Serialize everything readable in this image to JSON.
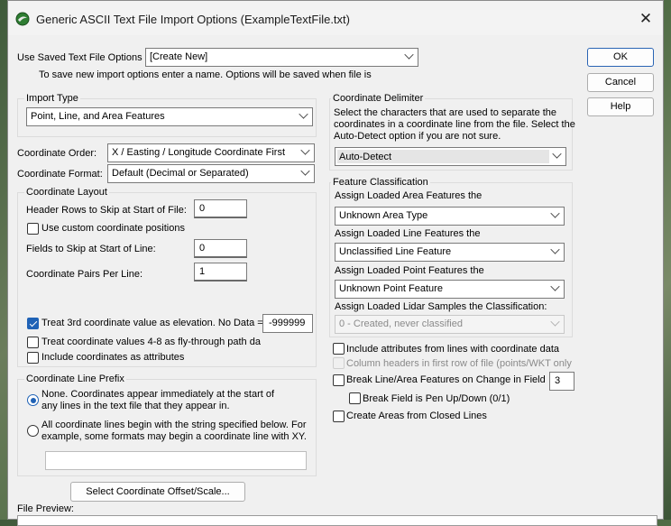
{
  "window": {
    "title": "Generic ASCII Text File Import Options (ExampleTextFile.txt)"
  },
  "saved": {
    "label": "Use Saved Text File Options",
    "value": "[Create New]",
    "hint": "To save new import options enter a name. Options will be saved when file is"
  },
  "buttons": {
    "ok": "OK",
    "cancel": "Cancel",
    "help": "Help",
    "offset": "Select Coordinate Offset/Scale..."
  },
  "import_type": {
    "label": "Import Type",
    "value": "Point, Line, and Area Features"
  },
  "coord_order": {
    "label": "Coordinate Order:",
    "value": "X / Easting / Longitude Coordinate First"
  },
  "coord_format": {
    "label": "Coordinate Format:",
    "value": "Default (Decimal or Separated)"
  },
  "layout": {
    "label": "Coordinate Layout",
    "header_rows_label": "Header Rows to Skip at Start of File:",
    "header_rows_value": "0",
    "custom_positions": "Use custom coordinate positions",
    "fields_skip_label": "Fields to Skip at Start of Line:",
    "fields_skip_value": "0",
    "pairs_label": "Coordinate Pairs Per Line:",
    "pairs_value": "1",
    "elev_label": "Treat 3rd coordinate value as elevation. No Data =",
    "elev_value": "-999999",
    "flythrough": "Treat coordinate values 4-8 as fly-through path da",
    "as_attrs": "Include coordinates as attributes"
  },
  "prefix": {
    "label": "Coordinate Line Prefix",
    "none_line1": "None. Coordinates appear immediately at the start of",
    "none_line2": "any lines in the text file that they appear in.",
    "all_line1": "All coordinate lines begin with the string specified below. For",
    "all_line2": "example, some formats may begin a coordinate line with XY."
  },
  "delimiter": {
    "label": "Coordinate Delimiter",
    "desc1": "Select the characters that are used to separate the",
    "desc2": "coordinates in a coordinate line from the file. Select the",
    "desc3": "Auto-Detect option if you are not sure.",
    "value": "Auto-Detect"
  },
  "classification": {
    "label": "Feature Classification",
    "area_label": "Assign Loaded Area Features the",
    "area_value": "Unknown Area Type",
    "line_label": "Assign Loaded Line Features the",
    "line_value": "Unclassified Line Feature",
    "point_label": "Assign Loaded Point Features the",
    "point_value": "Unknown Point Feature",
    "lidar_label": "Assign Loaded Lidar Samples the Classification:",
    "lidar_value": "0 - Created, never classified"
  },
  "options": {
    "include_attrs": "Include attributes from lines with coordinate data",
    "col_headers": "Column headers in first row of file (points/WKT only",
    "break_line": "Break Line/Area Features on Change in Field",
    "break_field": "3",
    "pen_up": "Break Field is Pen Up/Down (0/1)",
    "closed_lines": "Create Areas from Closed Lines"
  },
  "preview": {
    "label": "File Preview:"
  }
}
